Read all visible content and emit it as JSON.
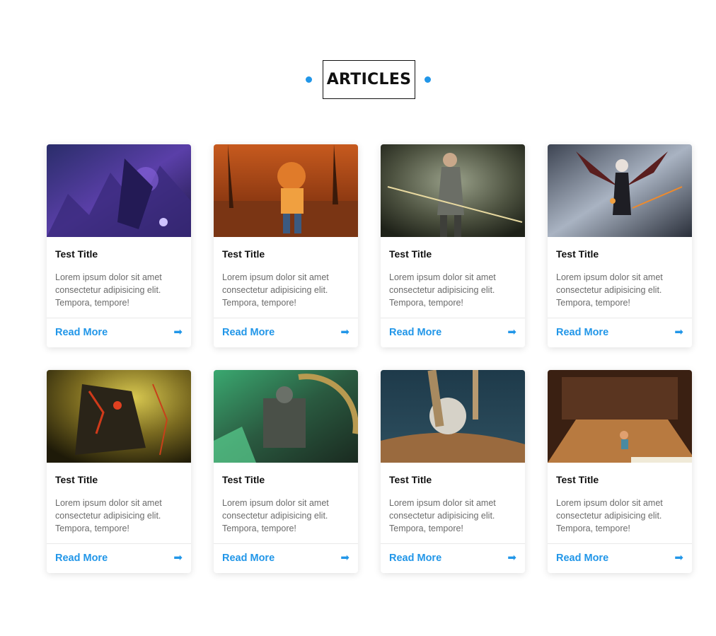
{
  "section": {
    "title": "ARTICLES",
    "accent_color": "#2196e8"
  },
  "cards": [
    {
      "title": "Test Title",
      "text": "Lorem ipsum dolor sit amet consectetur adipisicing elit. Tempora, tempore!",
      "link": "Read More",
      "icon": "arrow-right-icon",
      "image": "purple-fantasy-warrior-art"
    },
    {
      "title": "Test Title",
      "text": "Lorem ipsum dolor sit amet consectetur adipisicing elit. Tempora, tempore!",
      "link": "Read More",
      "icon": "arrow-right-icon",
      "image": "cartoon-tiger-character-forest"
    },
    {
      "title": "Test Title",
      "text": "Lorem ipsum dolor sit amet consectetur adipisicing elit. Tempora, tempore!",
      "link": "Read More",
      "icon": "arrow-right-icon",
      "image": "archer-heroine-forest"
    },
    {
      "title": "Test Title",
      "text": "Lorem ipsum dolor sit amet consectetur adipisicing elit. Tempora, tempore!",
      "link": "Read More",
      "icon": "arrow-right-icon",
      "image": "winged-dark-heroine-art"
    },
    {
      "title": "Test Title",
      "text": "Lorem ipsum dolor sit amet consectetur adipisicing elit. Tempora, tempore!",
      "link": "Read More",
      "icon": "arrow-right-icon",
      "image": "dark-armored-knight"
    },
    {
      "title": "Test Title",
      "text": "Lorem ipsum dolor sit amet consectetur adipisicing elit. Tempora, tempore!",
      "link": "Read More",
      "icon": "arrow-right-icon",
      "image": "green-throne-warrior"
    },
    {
      "title": "Test Title",
      "text": "Lorem ipsum dolor sit amet consectetur adipisicing elit. Tempora, tempore!",
      "link": "Read More",
      "icon": "arrow-right-icon",
      "image": "stone-ball-on-rock"
    },
    {
      "title": "Test Title",
      "text": "Lorem ipsum dolor sit amet consectetur adipisicing elit. Tempora, tempore!",
      "link": "Read More",
      "icon": "arrow-right-icon",
      "image": "wooden-room-game-scene"
    }
  ]
}
